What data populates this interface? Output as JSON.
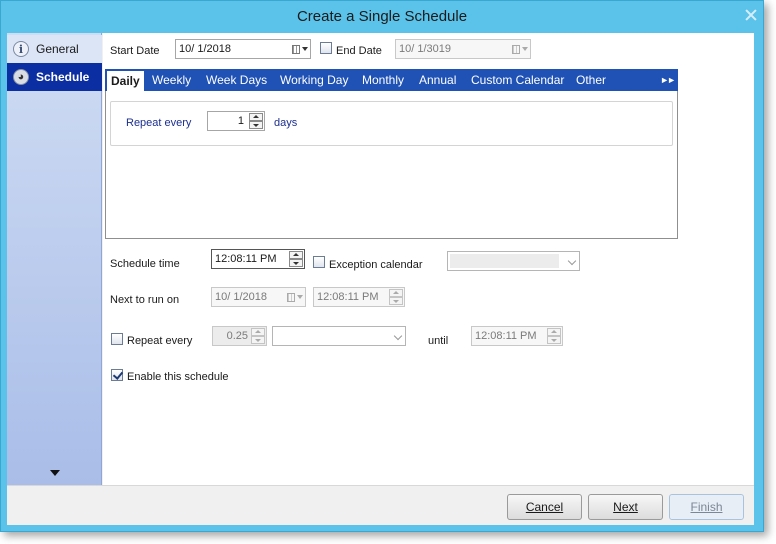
{
  "window": {
    "title": "Create a Single Schedule"
  },
  "sidebar": {
    "items": [
      {
        "label": "General",
        "icon": "info-icon",
        "selected": false
      },
      {
        "label": "Schedule",
        "icon": "clock-icon",
        "selected": true
      }
    ]
  },
  "top": {
    "start_date_label": "Start Date",
    "start_date_value": "10/  1/2018",
    "end_date_label": "End Date",
    "end_date_checked": false,
    "end_date_value": "10/  1/3019"
  },
  "tabs": {
    "items": [
      "Daily",
      "Weekly",
      "Week Days",
      "Working Day",
      "Monthly",
      "Annual",
      "Custom Calendar",
      "Other"
    ],
    "active": "Daily",
    "more_glyph": "►►"
  },
  "daily": {
    "repeat_label": "Repeat every",
    "repeat_value": "1",
    "unit_label": "days"
  },
  "schedule": {
    "time_label": "Schedule time",
    "time_value": "12:08:11 PM",
    "exception_label": "Exception calendar",
    "exception_checked": false,
    "exception_value": "",
    "next_run_label": "Next to run on",
    "next_run_date": "10/  1/2018",
    "next_run_time": "12:08:11 PM",
    "repeat_label": "Repeat every",
    "repeat_checked": false,
    "repeat_value": "0.25",
    "repeat_unit": "",
    "until_label": "until",
    "until_value": "12:08:11 PM",
    "enable_label": "Enable this schedule",
    "enable_checked": true
  },
  "footer": {
    "cancel_label": "Cancel",
    "next_label": "Next",
    "finish_label": "Finish"
  }
}
